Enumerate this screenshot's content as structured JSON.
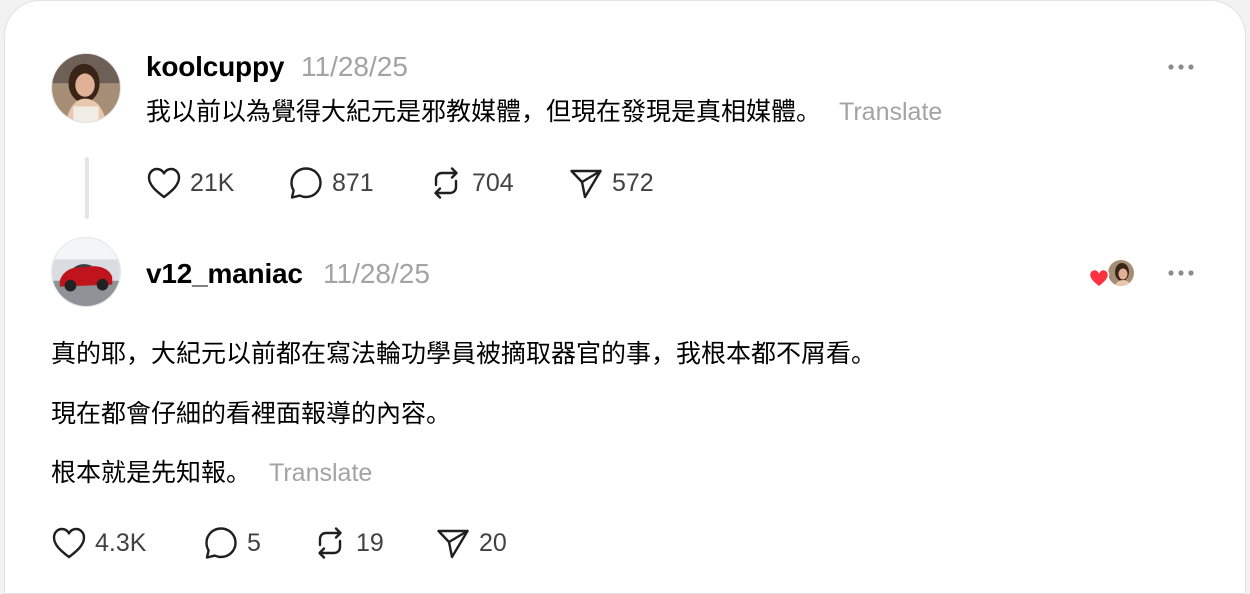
{
  "posts": [
    {
      "username": "koolcuppy",
      "timestamp": "11/28/25",
      "text_lines": [
        "我以前以為覺得大紀元是邪教媒體，但現在發現是真相媒體。"
      ],
      "translate_label": "Translate",
      "likes": "21K",
      "replies": "871",
      "reposts": "704",
      "shares": "572"
    },
    {
      "username": "v12_maniac",
      "timestamp": "11/28/25",
      "text_lines": [
        "真的耶，大紀元以前都在寫法輪功學員被摘取器官的事，我根本都不屑看。",
        "現在都會仔細的看裡面報導的內容。",
        "根本就是先知報。"
      ],
      "translate_label": "Translate",
      "likes": "4.3K",
      "replies": "5",
      "reposts": "19",
      "shares": "20"
    }
  ],
  "icons": {
    "like": "heart-icon",
    "reply": "comment-icon",
    "repost": "repost-icon",
    "share": "send-icon",
    "more": "more-dots-icon",
    "liked_by": "heart-badge-icon"
  },
  "colors": {
    "muted": "#a3a3a3",
    "heart_badge": "#ff3040",
    "thread_line": "#e5e5e5"
  }
}
